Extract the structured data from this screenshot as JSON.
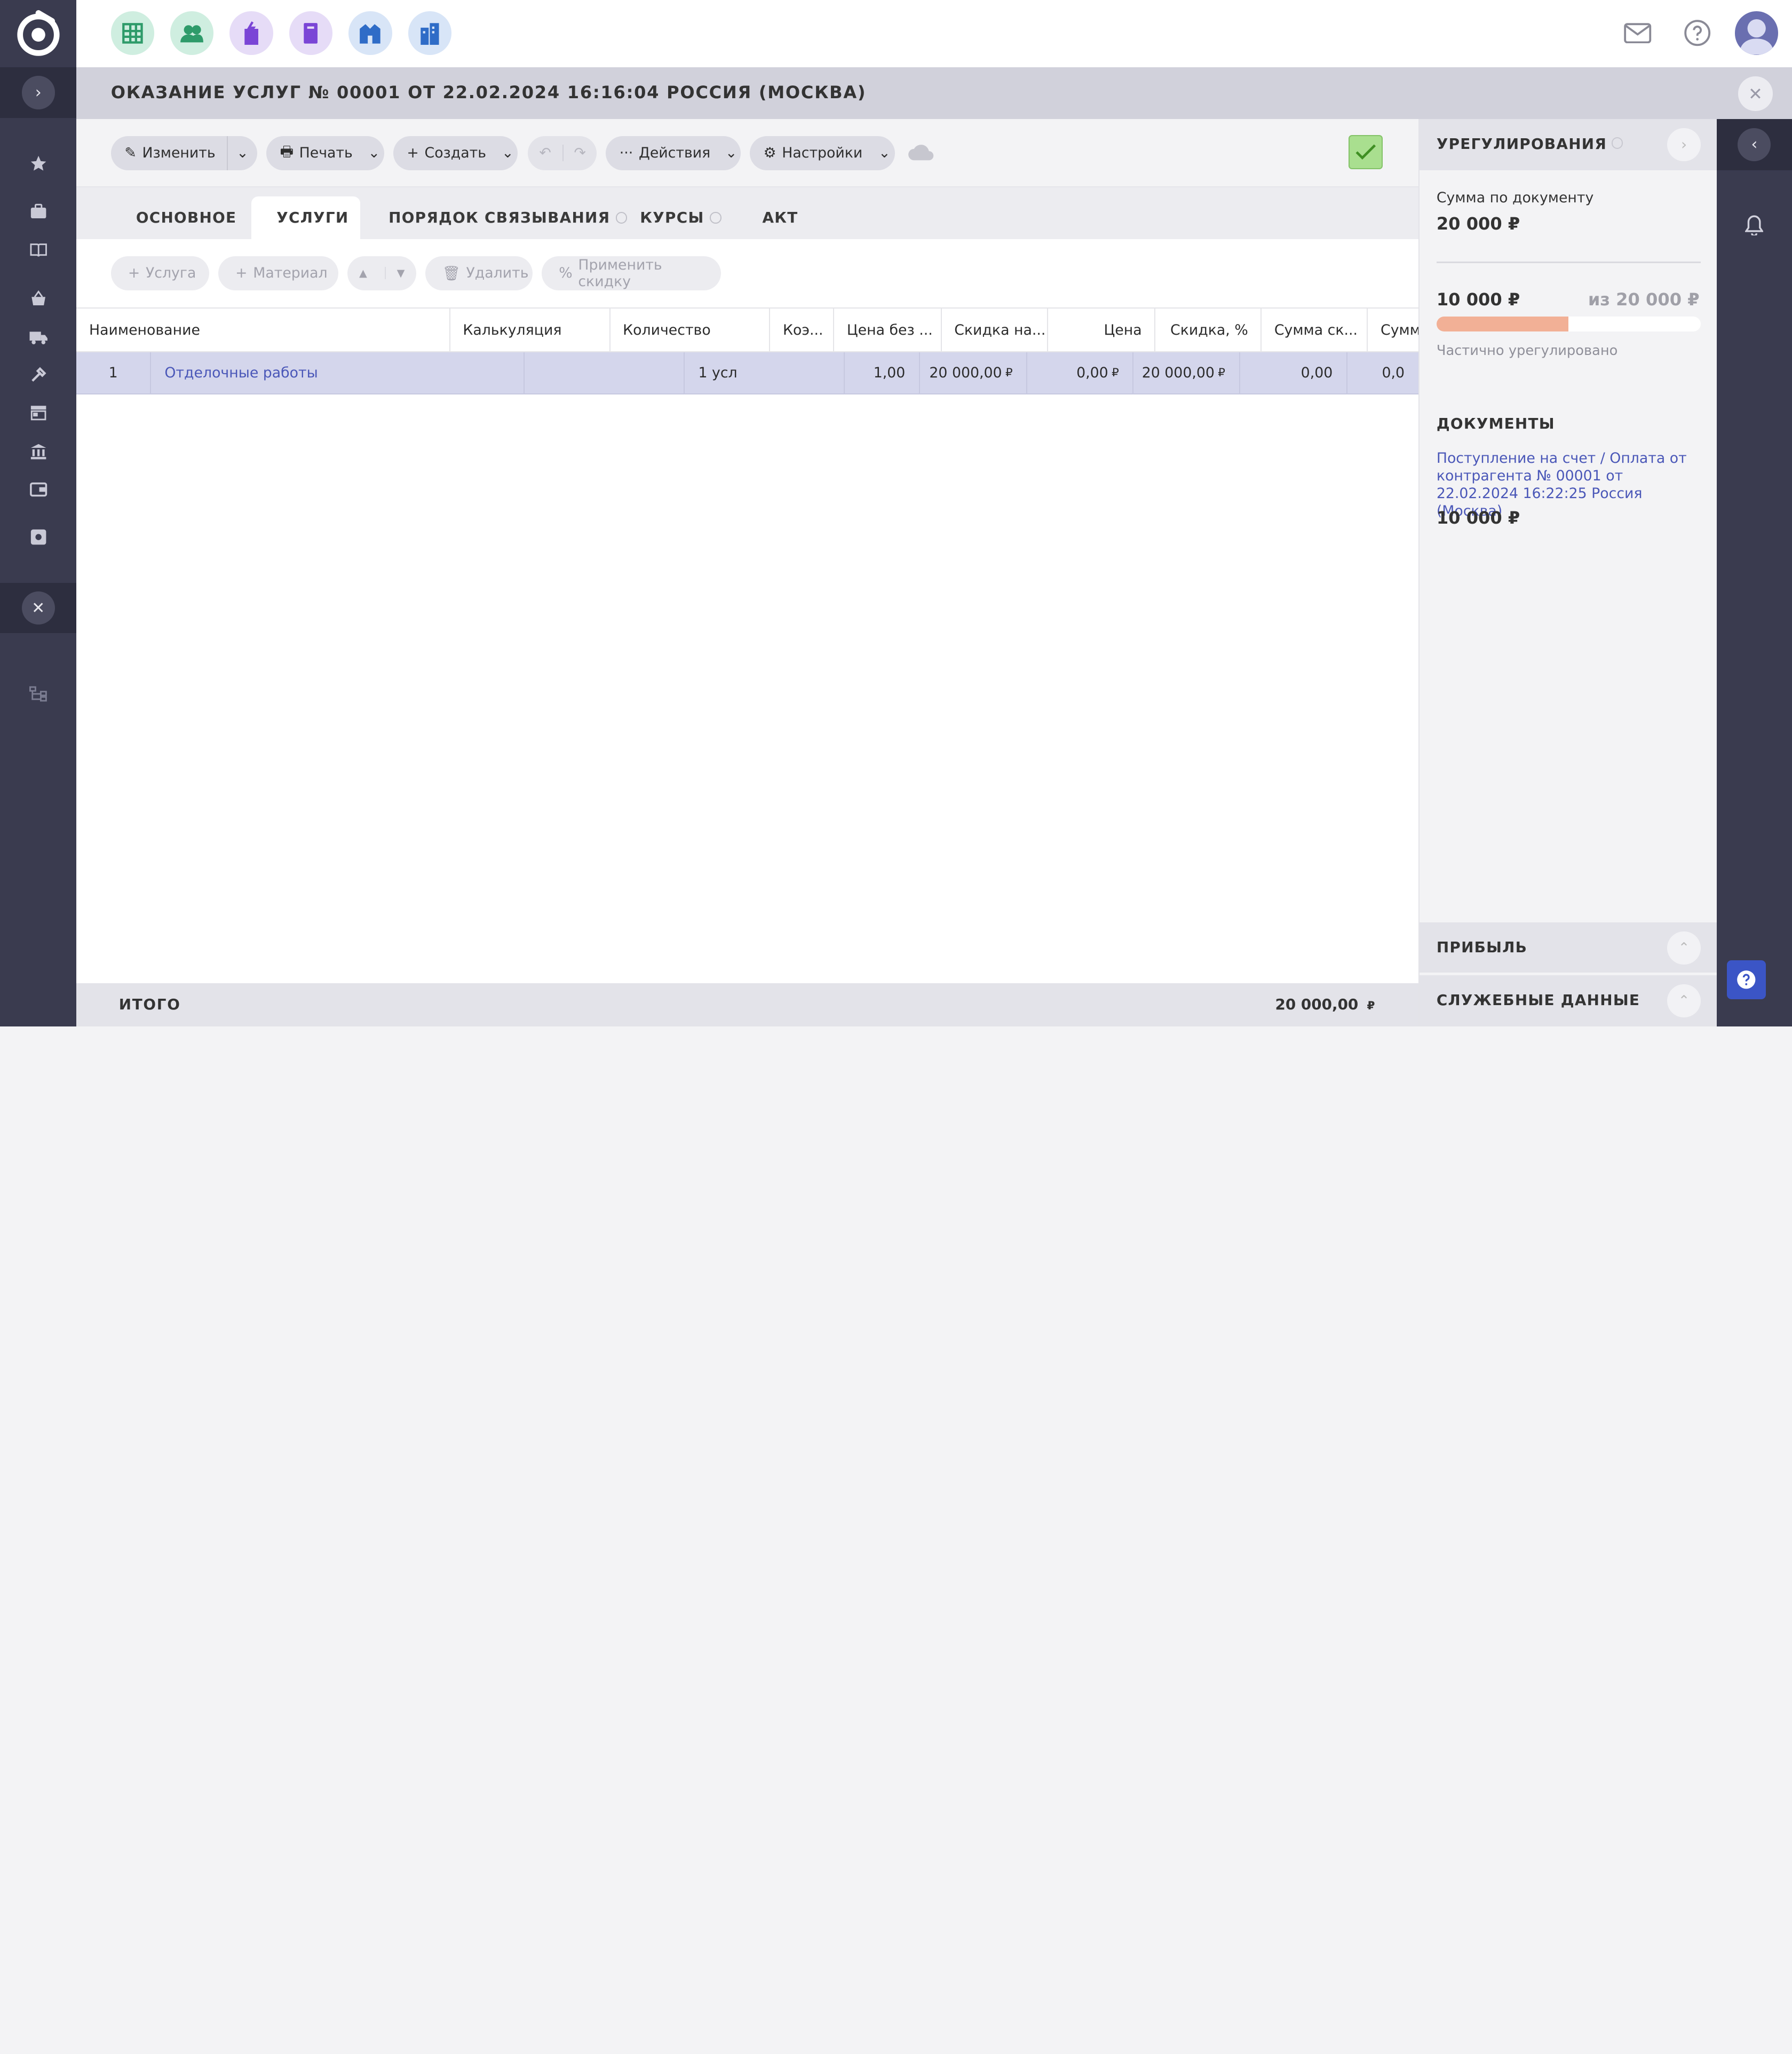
{
  "document": {
    "title": "ОКАЗАНИЕ УСЛУГ № 00001 ОТ 22.02.2024 16:16:04 РОССИЯ (МОСКВА)"
  },
  "apps": [
    {
      "name": "tables",
      "bg": "#cfeee0",
      "fg": "#2e9b6a"
    },
    {
      "name": "contacts",
      "bg": "#cfeee0",
      "fg": "#2e9b6a"
    },
    {
      "name": "documents",
      "bg": "#e6dcf7",
      "fg": "#7a45d6"
    },
    {
      "name": "book",
      "bg": "#e6dcf7",
      "fg": "#7a45d6"
    },
    {
      "name": "storage",
      "bg": "#d8e5f7",
      "fg": "#2f6cc7"
    },
    {
      "name": "buildings",
      "bg": "#d8e5f7",
      "fg": "#2f6cc7"
    }
  ],
  "toolbar": {
    "edit": "Изменить",
    "print": "Печать",
    "create": "Создать",
    "actions": "Действия",
    "settings": "Настройки"
  },
  "tabs": [
    "ОСНОВНОЕ",
    "УСЛУГИ",
    "ПОРЯДОК СВЯЗЫВАНИЯ",
    "КУРСЫ",
    "АКТ"
  ],
  "subtoolbar": {
    "service": "Услуга",
    "material": "Материал",
    "delete": "Удалить",
    "discount": "Применить скидку"
  },
  "grid": {
    "headers": [
      "Наименование",
      "Калькуляция",
      "Количество",
      "Коэ...",
      "Цена без ...",
      "Скидка на...",
      "Цена",
      "Скидка, %",
      "Сумма ск...",
      "Сумм"
    ],
    "row": {
      "num": "1",
      "name": "Отделочные работы",
      "qty": "1 усл",
      "coef": "1,00",
      "price_wo": "20 000,00",
      "discount_on": "0,00",
      "price": "20 000,00",
      "discount_pct": "0,00",
      "discount_sum": "0,0"
    },
    "currency": "₽"
  },
  "footer": {
    "label": "ИТОГО",
    "total": "20 000,00",
    "currency": "₽"
  },
  "settlement": {
    "title": "УРЕГУЛИРОВАНИЯ",
    "doc_sum_label": "Сумма по документу",
    "doc_sum": "20 000 ₽",
    "paid": "10 000 ₽",
    "of": "из 20 000 ₽",
    "progress": 0.5,
    "status": "Частично урегулировано",
    "docs_title": "ДОКУМЕНТЫ",
    "doc_link": "Поступление на счет / Оплата от контрагента № 00001 от 22.02.2024 16:22:25 Россия (Москва)",
    "doc_amount": "10 000 ₽",
    "profit": "ПРИБЫЛЬ",
    "service_data": "СЛУЖЕБНЫЕ ДАННЫЕ"
  }
}
